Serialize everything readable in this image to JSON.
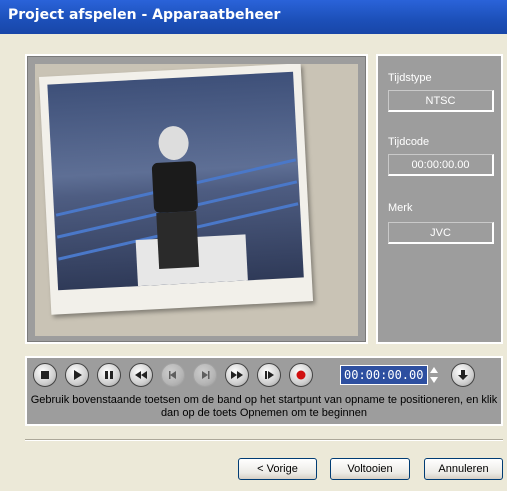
{
  "window": {
    "title": "Project afspelen - Apparaatbeheer"
  },
  "info": {
    "tijdstype_label": "Tijdstype",
    "tijdstype_value": "NTSC",
    "tijdcode_label": "Tijdcode",
    "tijdcode_value": "00:00:00.00",
    "merk_label": "Merk",
    "merk_value": "JVC"
  },
  "controls": {
    "buttons": [
      {
        "name": "stop-icon",
        "enabled": true
      },
      {
        "name": "play-icon",
        "enabled": true
      },
      {
        "name": "pause-icon",
        "enabled": true
      },
      {
        "name": "rewind-icon",
        "enabled": true
      },
      {
        "name": "step-back-icon",
        "enabled": false
      },
      {
        "name": "step-forward-icon",
        "enabled": false
      },
      {
        "name": "fast-forward-icon",
        "enabled": true
      },
      {
        "name": "skip-forward-icon",
        "enabled": true
      },
      {
        "name": "record-icon",
        "enabled": true
      }
    ],
    "timecode": "00:00:00.00",
    "hint": "Gebruik bovenstaande toetsen om de band op het startpunt van opname te positioneren, en klik dan op de toets Opnemen om te beginnen"
  },
  "footer": {
    "back_label": "< Vorige",
    "finish_label": "Voltooien",
    "cancel_label": "Annuleren"
  },
  "colors": {
    "titlebar": "#1c4fb8",
    "panel": "#9d9d9d",
    "timecode_bg": "#2d4fa0",
    "record": "#d01010"
  }
}
